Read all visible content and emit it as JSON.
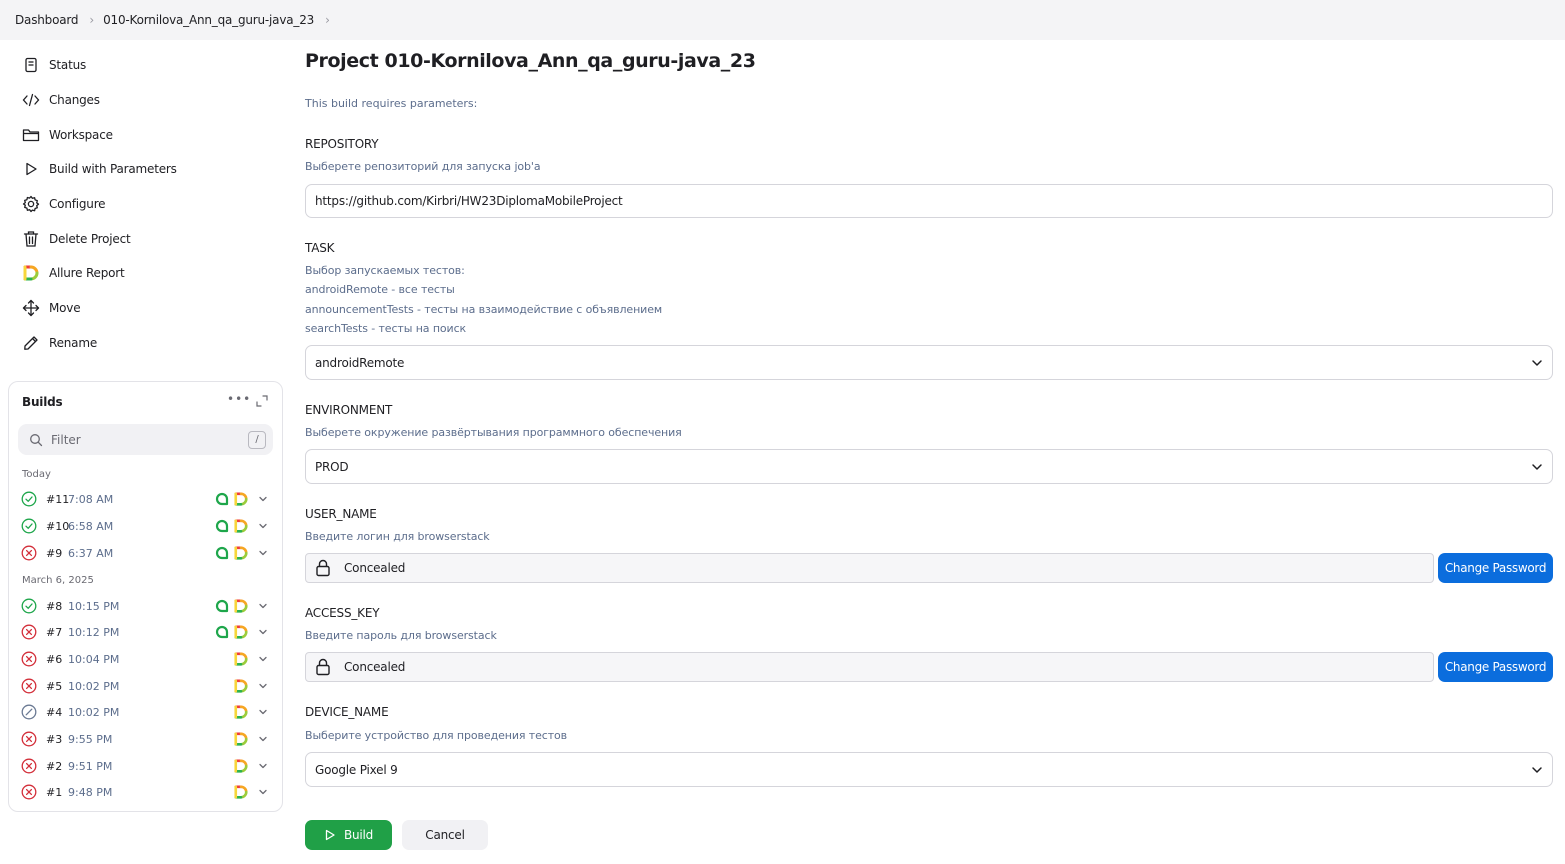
{
  "breadcrumb": [
    "Dashboard",
    "010-Kornilova_Ann_qa_guru-java_23"
  ],
  "sidebar": {
    "items": [
      {
        "label": "Status",
        "icon": "document-icon"
      },
      {
        "label": "Changes",
        "icon": "code-icon"
      },
      {
        "label": "Workspace",
        "icon": "folder-icon"
      },
      {
        "label": "Build with Parameters",
        "icon": "play-icon"
      },
      {
        "label": "Configure",
        "icon": "gear-icon"
      },
      {
        "label": "Delete Project",
        "icon": "trash-icon"
      },
      {
        "label": "Allure Report",
        "icon": "allure-icon"
      },
      {
        "label": "Move",
        "icon": "move-icon"
      },
      {
        "label": "Rename",
        "icon": "pencil-icon"
      }
    ]
  },
  "builds": {
    "title": "Builds",
    "filter_placeholder": "Filter",
    "filter_shortcut": "/",
    "groups": [
      {
        "label": "Today",
        "rows": [
          {
            "number": "#11",
            "time": "7:08 AM",
            "status": "success",
            "has_console": true
          },
          {
            "number": "#10",
            "time": "6:58 AM",
            "status": "success",
            "has_console": true
          },
          {
            "number": "#9",
            "time": "6:37 AM",
            "status": "failed",
            "has_console": true
          }
        ]
      },
      {
        "label": "March 6, 2025",
        "rows": [
          {
            "number": "#8",
            "time": "10:15 PM",
            "status": "success",
            "has_console": true
          },
          {
            "number": "#7",
            "time": "10:12 PM",
            "status": "failed",
            "has_console": true
          },
          {
            "number": "#6",
            "time": "10:04 PM",
            "status": "failed",
            "has_console": false
          },
          {
            "number": "#5",
            "time": "10:02 PM",
            "status": "failed",
            "has_console": false
          },
          {
            "number": "#4",
            "time": "10:02 PM",
            "status": "aborted",
            "has_console": false
          },
          {
            "number": "#3",
            "time": "9:55 PM",
            "status": "failed",
            "has_console": false
          },
          {
            "number": "#2",
            "time": "9:51 PM",
            "status": "failed",
            "has_console": false
          },
          {
            "number": "#1",
            "time": "9:48 PM",
            "status": "failed",
            "has_console": false
          }
        ]
      }
    ]
  },
  "main": {
    "title": "Project 010-Kornilova_Ann_qa_guru-java_23",
    "intro": "This build requires parameters:",
    "params": {
      "repository": {
        "name": "REPOSITORY",
        "description": "Выберете репозиторий для запуска job'a",
        "value": "https://github.com/Kirbri/HW23DiplomaMobileProject"
      },
      "task": {
        "name": "TASK",
        "description": [
          "Выбор запускаемых тестов:",
          "androidRemote - все тесты",
          "announcementTests - тесты на взаимодействие с объявлением",
          "searchTests - тесты на поиск"
        ],
        "value": "androidRemote"
      },
      "environment": {
        "name": "ENVIRONMENT",
        "description": "Выберете окружение развёртывания программного обеспечения",
        "value": "PROD"
      },
      "user_name": {
        "name": "USER_NAME",
        "description": "Введите логин для browserstack",
        "value": "Concealed",
        "button": "Change Password"
      },
      "access_key": {
        "name": "ACCESS_KEY",
        "description": "Введите пароль для browserstack",
        "value": "Concealed",
        "button": "Change Password"
      },
      "device_name": {
        "name": "DEVICE_NAME",
        "description": "Выберите устройство для проведения тестов",
        "value": "Google Pixel 9"
      }
    },
    "build_button": "Build",
    "cancel_button": "Cancel"
  },
  "colors": {
    "success": "#1ea64b",
    "failed": "#d32f3a",
    "aborted": "#6b7a94",
    "primary": "#0b6ddd",
    "build": "#20a047",
    "link_text": "#5c6d8c"
  }
}
